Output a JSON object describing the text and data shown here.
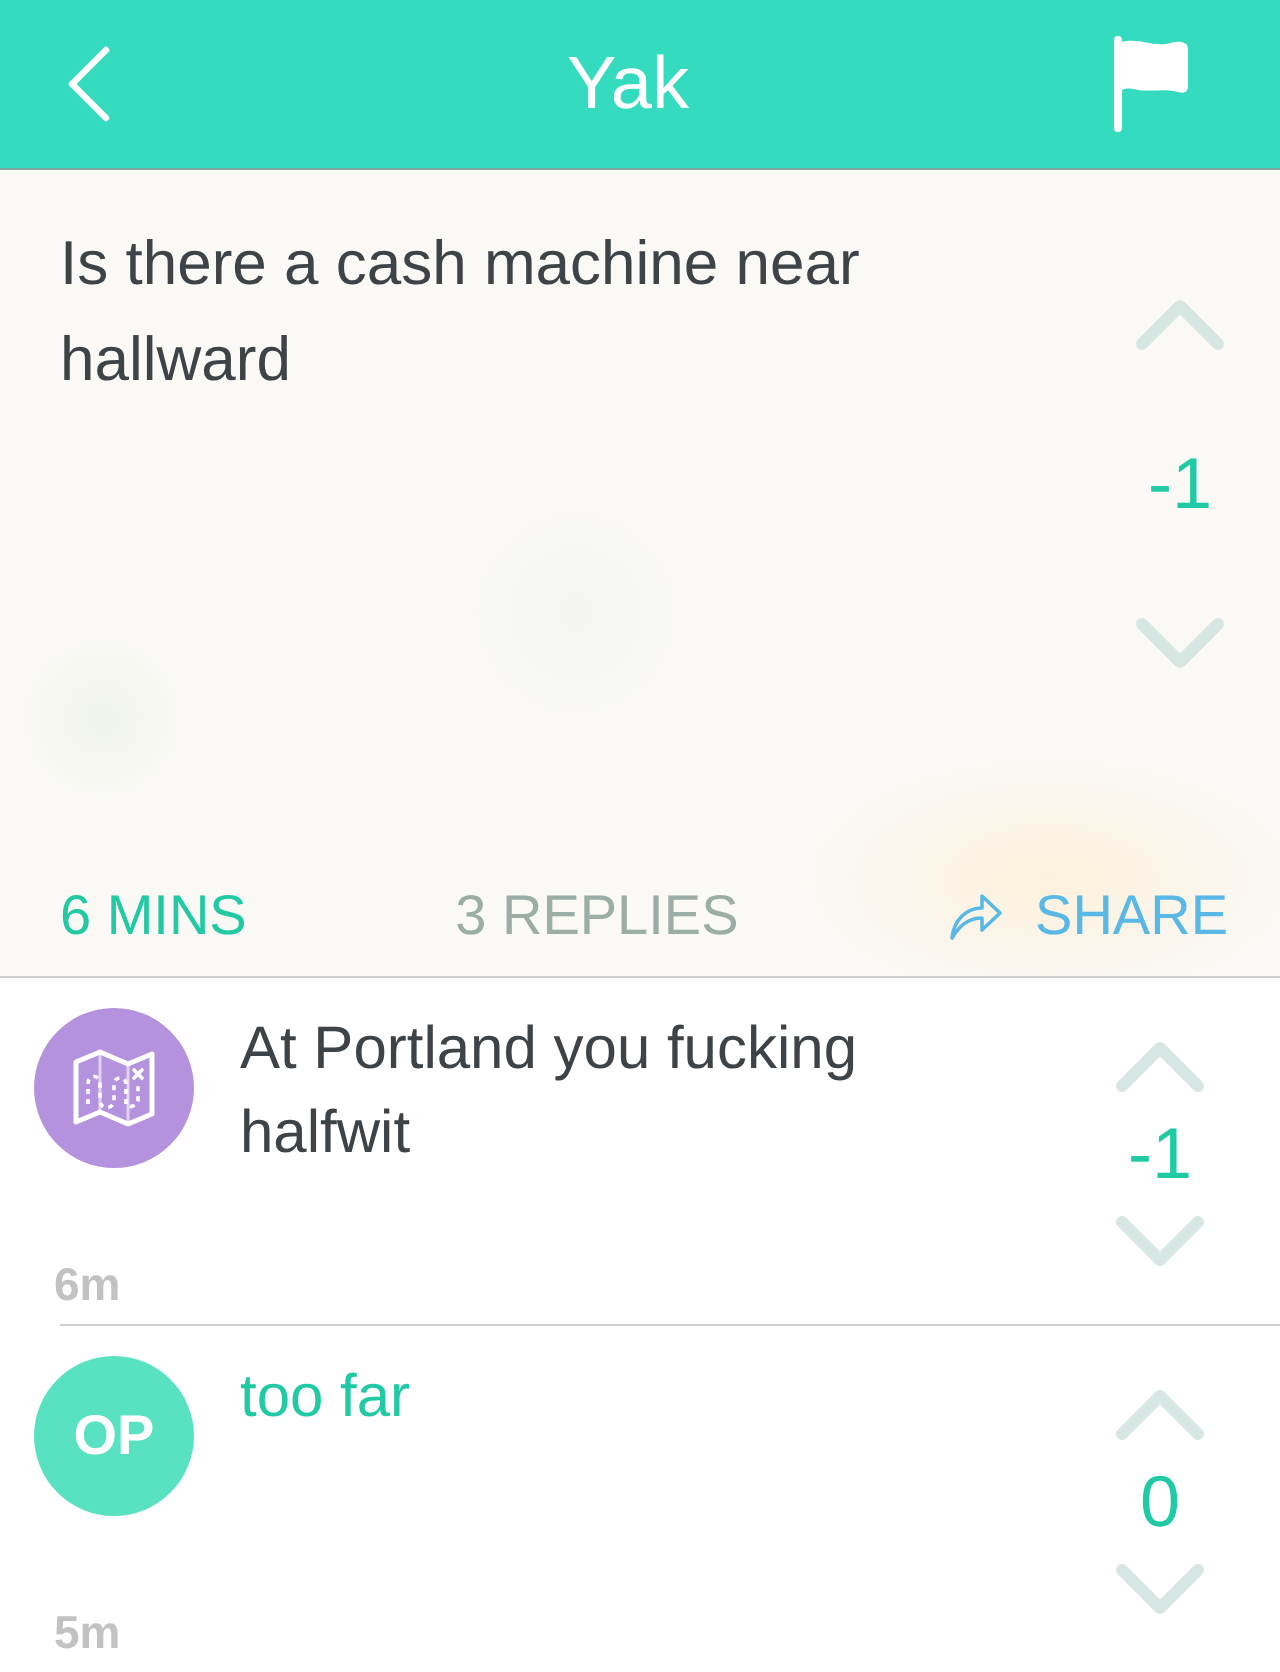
{
  "header": {
    "title": "Yak"
  },
  "post": {
    "text": "Is there a cash machine near hallward",
    "score": "-1",
    "time": "6 MINS",
    "replies": "3 REPLIES",
    "share": "SHARE"
  },
  "replies": [
    {
      "kind": "icon",
      "color": "#b592dd",
      "text": "At Portland you fucking halfwit",
      "score": "-1",
      "time": "6m"
    },
    {
      "kind": "op",
      "color": "#58e2c2",
      "badge": "OP",
      "text": "too far",
      "score": "0",
      "time": "5m"
    }
  ]
}
